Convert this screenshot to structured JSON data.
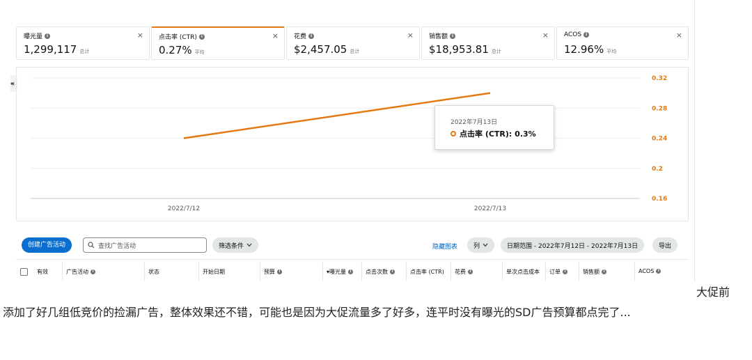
{
  "cards": [
    {
      "title": "曝光量",
      "value": "1,299,117",
      "agg": "总计",
      "active": false
    },
    {
      "title": "点击率 (CTR)",
      "value": "0.27%",
      "agg": "平均",
      "active": true
    },
    {
      "title": "花费",
      "value": "$2,457.05",
      "agg": "总计",
      "active": false
    },
    {
      "title": "销售额",
      "value": "$18,953.81",
      "agg": "总计",
      "active": false
    },
    {
      "title": "ACOS",
      "value": "12.96%",
      "agg": "平均",
      "active": false
    }
  ],
  "close_glyph": "×",
  "collapse_glyph": "«",
  "chart_data": {
    "type": "line",
    "x": [
      "2022/7/12",
      "2022/7/13"
    ],
    "series": [
      {
        "name": "点击率 (CTR)",
        "values": [
          0.24,
          0.3
        ]
      }
    ],
    "y_ticks": [
      "0.32",
      "0.28",
      "0.24",
      "0.2",
      "0.16"
    ],
    "ylim": [
      0.16,
      0.32
    ],
    "y_axis_side": "right",
    "color": "#e47911",
    "grid": true
  },
  "tooltip": {
    "date": "2022年7月13日",
    "label": "点击率 (CTR): 0.3%"
  },
  "toolbar": {
    "create_label": "创建广告活动",
    "search_placeholder": "查找广告活动",
    "filter_label": "筛选条件",
    "hide_chart_label": "隐藏图表",
    "columns_label": "列",
    "date_range_label": "日期范围 - 2022年7月12日 - 2022年7月13日",
    "export_label": "导出"
  },
  "table": {
    "columns": [
      {
        "label": "有效",
        "info": false,
        "x": 0
      },
      {
        "label": "广告活动",
        "info": true,
        "x": 0
      },
      {
        "label": "状态",
        "info": false,
        "x": 0
      },
      {
        "label": "开始日期",
        "info": false,
        "x": 0
      },
      {
        "label": "预算",
        "info": true,
        "x": 0
      },
      {
        "label": "▾曝光量",
        "info": true,
        "x": 0
      },
      {
        "label": "点击次数",
        "info": true,
        "x": 0
      },
      {
        "label": "点击率 (CTR)",
        "info": false,
        "x": 0
      },
      {
        "label": "花费",
        "info": true,
        "x": 0
      },
      {
        "label": "单次点击成本",
        "info": false,
        "x": 0
      },
      {
        "label": "订单",
        "info": true,
        "x": 0
      },
      {
        "label": "销售额",
        "info": true,
        "x": 0
      },
      {
        "label": "ACOS",
        "info": true,
        "x": 0
      }
    ]
  },
  "article": {
    "side_text": "大促前",
    "paragraph": "添加了好几组低竞价的捡漏广告，整体效果还不错，可能也是因为大促流量多了好多，连平时没有曝光的SD广告预算都点完了..."
  }
}
